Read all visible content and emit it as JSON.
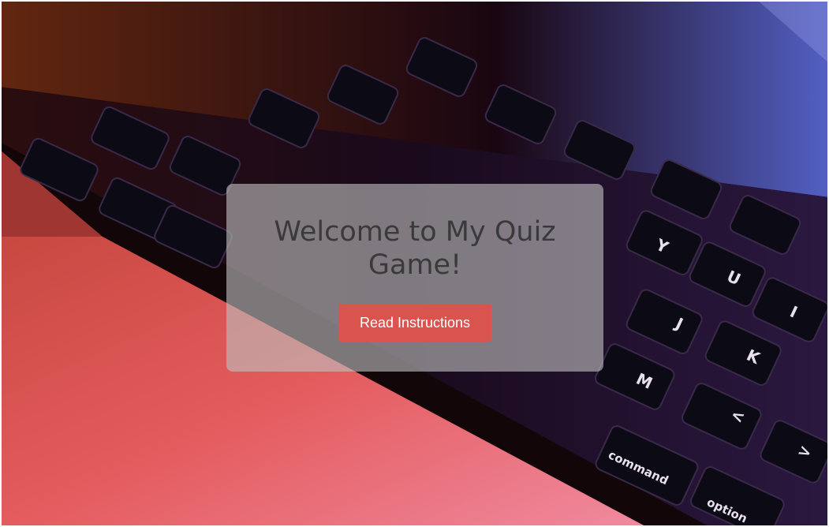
{
  "background": {
    "image": "laptop-keyboard-photo",
    "accent_dark": "#0d0610",
    "accent_warm": "#e0566a"
  },
  "welcome_card": {
    "title": "Welcome to My Quiz Game!",
    "button_label": "Read Instructions",
    "button_color": "#d9534f",
    "card_color": "#bebebe"
  }
}
